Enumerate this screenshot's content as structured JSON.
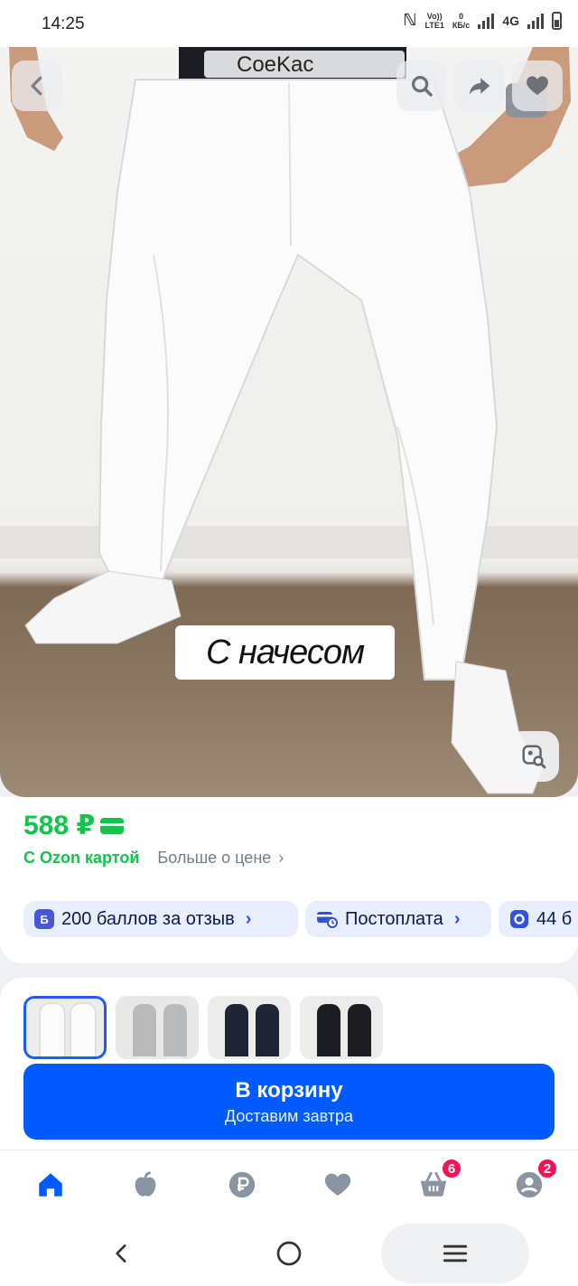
{
  "status_bar": {
    "time": "14:25",
    "volte_top": "Vo))",
    "volte_bottom": "LTE1",
    "speed_value": "0",
    "speed_unit": "КБ/с",
    "network": "4G"
  },
  "hero": {
    "waistband_text": "CoeKac",
    "caption": "С начесом",
    "icons": [
      "back-icon",
      "search-icon",
      "share-icon",
      "heart-icon",
      "image-search-icon"
    ]
  },
  "price": {
    "value": "588 ₽",
    "with_ozon_card": "С Ozon картой",
    "more_about_price": "Больше о цене",
    "accent_color": "#10c44c"
  },
  "chips": [
    {
      "icon_letter": "Б",
      "label": "200 баллов за отзыв"
    },
    {
      "label": "Постоплата"
    },
    {
      "label": "44 б"
    }
  ],
  "variants": {
    "colors": [
      "white",
      "grey",
      "navy",
      "black"
    ],
    "selected_index": 0
  },
  "cart": {
    "button_label": "В корзину",
    "delivery_label": "Доставим завтра",
    "button_color": "#005bff"
  },
  "bottom_nav": {
    "items": [
      "home",
      "fresh",
      "ozon-card",
      "favorites",
      "cart",
      "profile"
    ],
    "cart_badge": "6",
    "profile_badge": "2"
  }
}
